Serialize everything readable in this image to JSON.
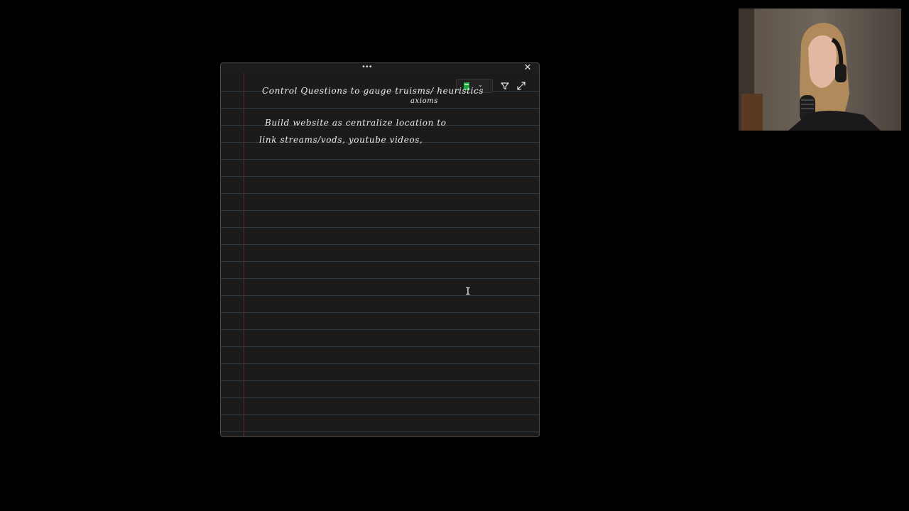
{
  "note": {
    "drag_handle_glyph": "•••",
    "close_glyph": "✕",
    "toolbar": {
      "pen_color": "#1fa83d",
      "pen_chevron_glyph": "⌄",
      "filter_icon": "funnel-icon",
      "expand_icon": "expand-icon"
    },
    "handwriting": {
      "line_1": "Control Questions to gauge truisms/ heuristics",
      "line_1_sub": "axioms",
      "line_2": "Build website as centralize location to",
      "line_3": "link streams/vods, youtube videos,"
    },
    "colors": {
      "paper": "#1b1b1b",
      "rule_line": "#2e3a44",
      "margin_line": "#5a2a2e",
      "ink": "#ececec"
    }
  },
  "cursor": {
    "glyph": "I"
  },
  "webcam": {
    "description_icon": "webcam-feed"
  }
}
